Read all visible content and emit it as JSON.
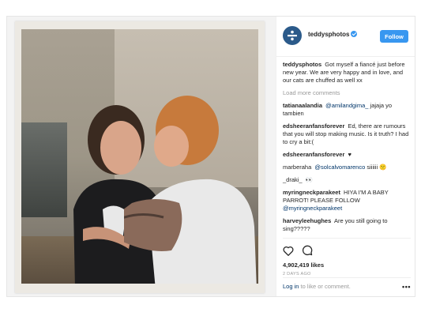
{
  "header": {
    "username": "teddysphotos",
    "follow_label": "Follow"
  },
  "caption": {
    "username": "teddysphotos",
    "text": "Got myself a fiancé just before new year. We are very happy and in love, and our cats are chuffed as well xx"
  },
  "load_more": "Load more comments",
  "comments": [
    {
      "user": "tatianaalandia",
      "mention": "@amilandgima_",
      "text": "jajaja yo tambien"
    },
    {
      "user": "edsheeranfansforever",
      "mention": "",
      "text": "Ed, there are rumours that you will stop making music. Is it truth? I had to cry a bit:("
    },
    {
      "user": "edsheeranfansforever",
      "mention": "",
      "text": "♥"
    },
    {
      "user": "marberaha",
      "mention": "@solcalvomarenco",
      "text": "siiiiii 🙁"
    },
    {
      "user": "_draki_",
      "mention": "",
      "text": "👀"
    },
    {
      "user": "myringneckparakeet",
      "mention": "",
      "text": "HIYA I'M A BABY PARROT! PLEASE FOLLOW"
    },
    {
      "user": "harveyleehughes",
      "mention": "",
      "text": "Are you still going to sing?????"
    }
  ],
  "parakeet_mention": "@myringneckparakeet",
  "likes": "4,902,419 likes",
  "time_ago": "2 DAYS AGO",
  "comment_bar": {
    "login": "Log in",
    "rest": "to like or comment.",
    "more": "•••"
  },
  "icons": {
    "like": "heart-icon",
    "comment": "comment-icon",
    "more": "more-options-icon"
  },
  "colors": {
    "accent": "#3897f0",
    "link": "#003569",
    "muted": "#999999"
  }
}
